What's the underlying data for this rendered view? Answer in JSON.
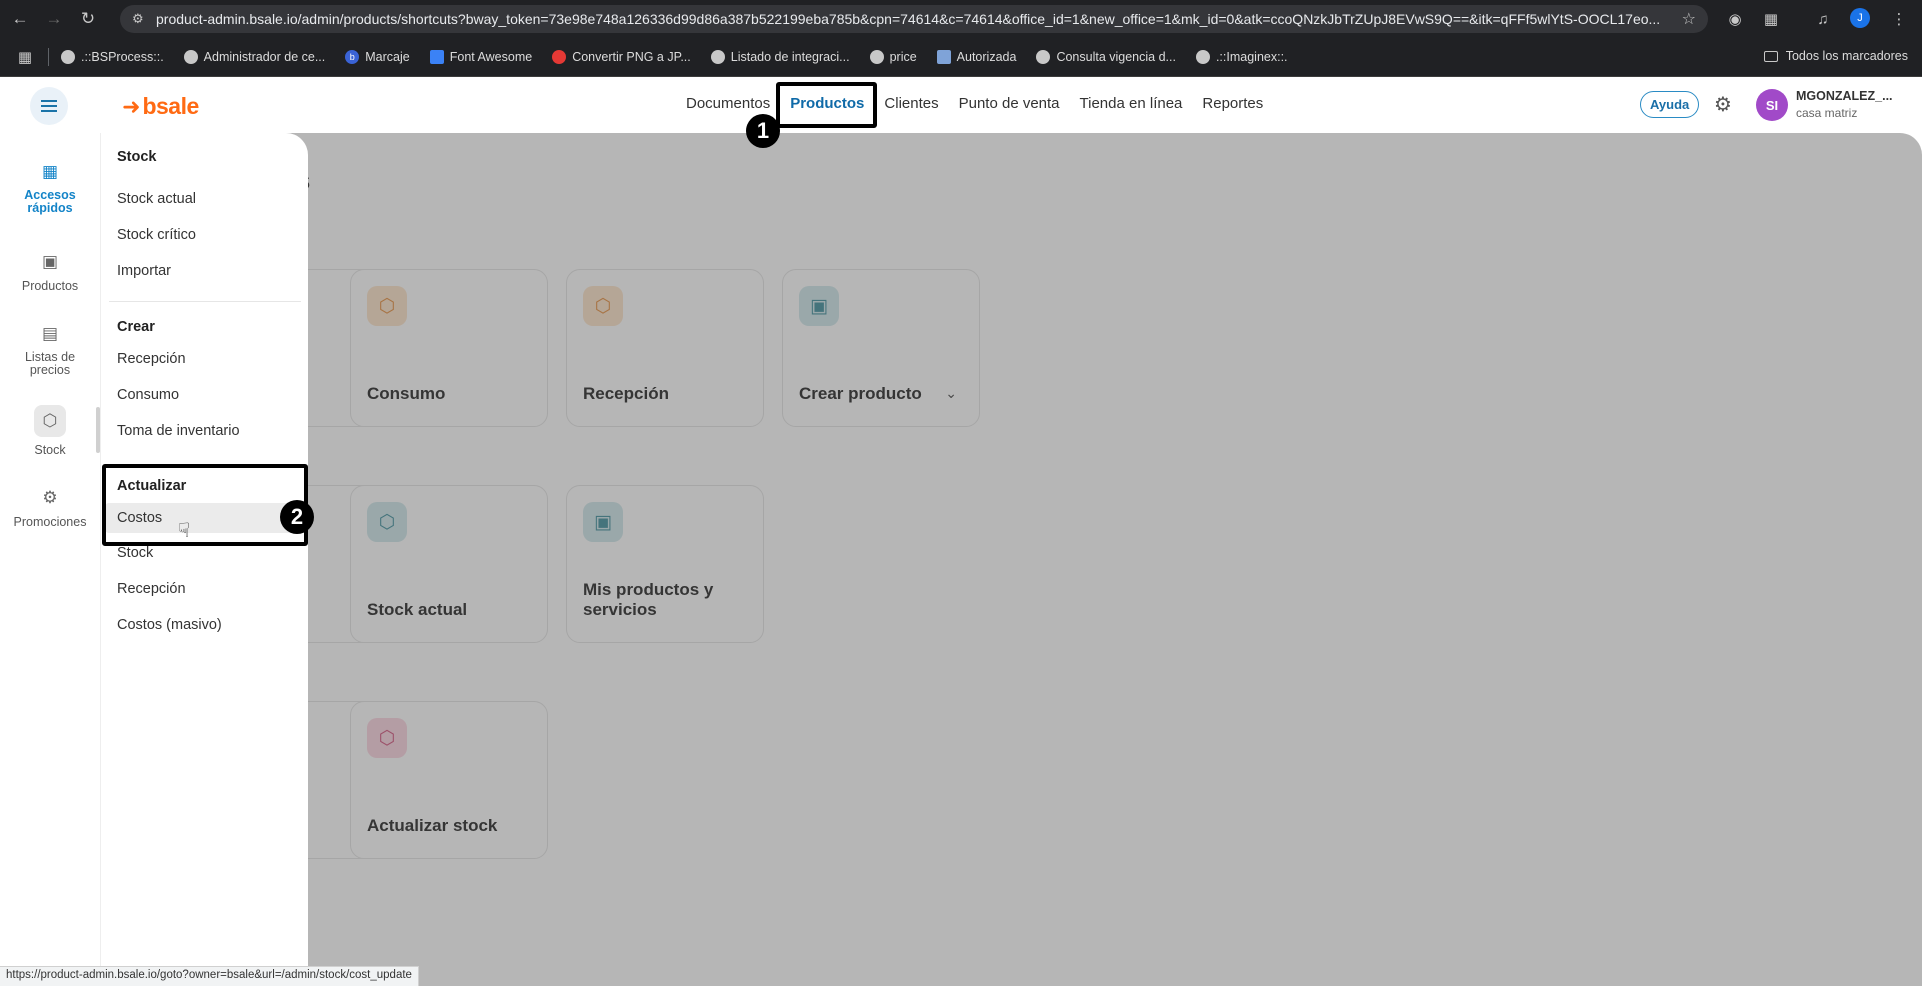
{
  "browser": {
    "url": "product-admin.bsale.io/admin/products/shortcuts?bway_token=73e98e748a126336d99d86a387b522199eba785b&cpn=74614&c=74614&office_id=1&new_office=1&mk_id=0&atk=ccoQNzkJbTrZUpJ8EVwS9Q==&itk=qFFf5wlYtS-OOCL17eo...",
    "status_url": "https://product-admin.bsale.io/goto?owner=bsale&url=/admin/stock/cost_update",
    "profile_initial": "J",
    "bookmarks": [
      {
        "label": ".::BSProcess::.",
        "icon": "globe-icon"
      },
      {
        "label": "Administrador de ce...",
        "icon": "globe-icon"
      },
      {
        "label": "Marcaje",
        "icon": "b-icon"
      },
      {
        "label": "Font Awesome",
        "icon": "flag-icon"
      },
      {
        "label": "Convertir PNG a JP...",
        "icon": "convert-icon"
      },
      {
        "label": "Listado de integraci...",
        "icon": "globe-icon"
      },
      {
        "label": "price",
        "icon": "globe-icon"
      },
      {
        "label": "Autorizada",
        "icon": "chart-icon"
      },
      {
        "label": "Consulta vigencia d...",
        "icon": "globe-icon"
      },
      {
        "label": ".::Imaginex::.",
        "icon": "globe-icon"
      }
    ],
    "all_bookmarks": "Todos los marcadores"
  },
  "header": {
    "logo": "bsale",
    "nav": [
      "Documentos",
      "Productos",
      "Clientes",
      "Punto de venta",
      "Tienda en línea",
      "Reportes"
    ],
    "active_nav": "Productos",
    "help": "Ayuda",
    "user_initials": "SI",
    "user_name": "MGONZALEZ_...",
    "user_office": "casa matriz"
  },
  "rail": {
    "items": [
      {
        "label": "Accesos rápidos",
        "icon": "dashboard-icon",
        "active": true
      },
      {
        "label": "Productos",
        "icon": "products-icon"
      },
      {
        "label": "Listas de precios",
        "icon": "price-list-icon"
      },
      {
        "label": "Stock",
        "icon": "box-icon"
      },
      {
        "label": "Promociones",
        "icon": "promo-icon"
      }
    ]
  },
  "main": {
    "title_fragment": "os",
    "cards": [
      {
        "label": "Consumo",
        "icon": "box-minus-icon",
        "color": "#e58d3c"
      },
      {
        "label": "Recepción",
        "icon": "box-plus-icon",
        "color": "#e58d3c"
      },
      {
        "label": "Crear producto",
        "icon": "product-create-icon",
        "color": "#3d8e9c"
      },
      {
        "label": "Stock actual",
        "icon": "box-icon",
        "color": "#3d8e9c"
      },
      {
        "label": "Mis productos y servicios",
        "icon": "products-icon",
        "color": "#3d8e9c"
      },
      {
        "label": "Actualizar stock",
        "icon": "box-refresh-icon",
        "color": "#d2507a"
      }
    ],
    "clipped_fragment": "a"
  },
  "menu": {
    "groups": [
      {
        "title": "Stock",
        "items": [
          "Stock actual",
          "Stock crítico",
          "Importar"
        ]
      },
      {
        "title": "Crear",
        "items": [
          "Recepción",
          "Consumo",
          "Toma de inventario"
        ]
      },
      {
        "title": "Actualizar",
        "items": [
          "Costos",
          "Stock",
          "Recepción",
          "Costos (masivo)"
        ]
      }
    ],
    "hovered": "Costos"
  },
  "annotations": [
    "1",
    "2"
  ]
}
